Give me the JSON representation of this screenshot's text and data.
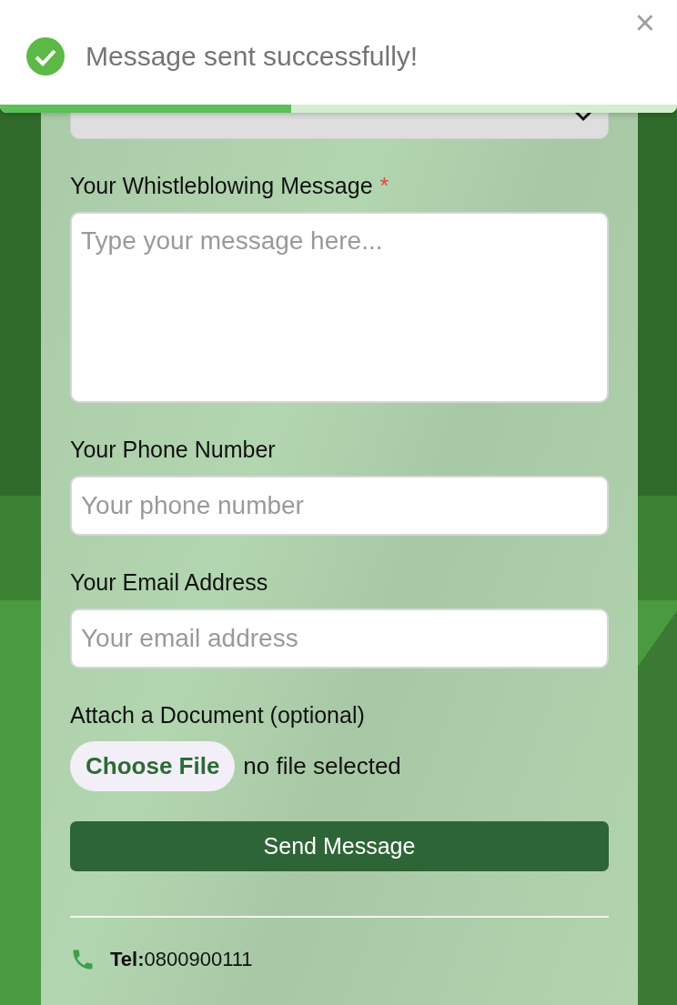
{
  "toast": {
    "message": "Message sent successfully!",
    "close": "×",
    "level": 0.43
  },
  "form": {
    "fields": [
      {
        "kind": "textarea",
        "label": "Your Whistleblowing Message",
        "required_mark": "*",
        "placeholder": "Type your message here..."
      },
      {
        "kind": "input",
        "label": "Your Phone Number",
        "placeholder": "Your phone number"
      },
      {
        "kind": "input",
        "label": "Your Email Address",
        "placeholder": "Your email address"
      }
    ],
    "attachment": {
      "label": "Attach a Document (optional)",
      "button": "Choose File",
      "status": "no file selected"
    },
    "submit": "Send Message"
  },
  "contact": {
    "label": "Tel:",
    "value": "0800900111"
  }
}
